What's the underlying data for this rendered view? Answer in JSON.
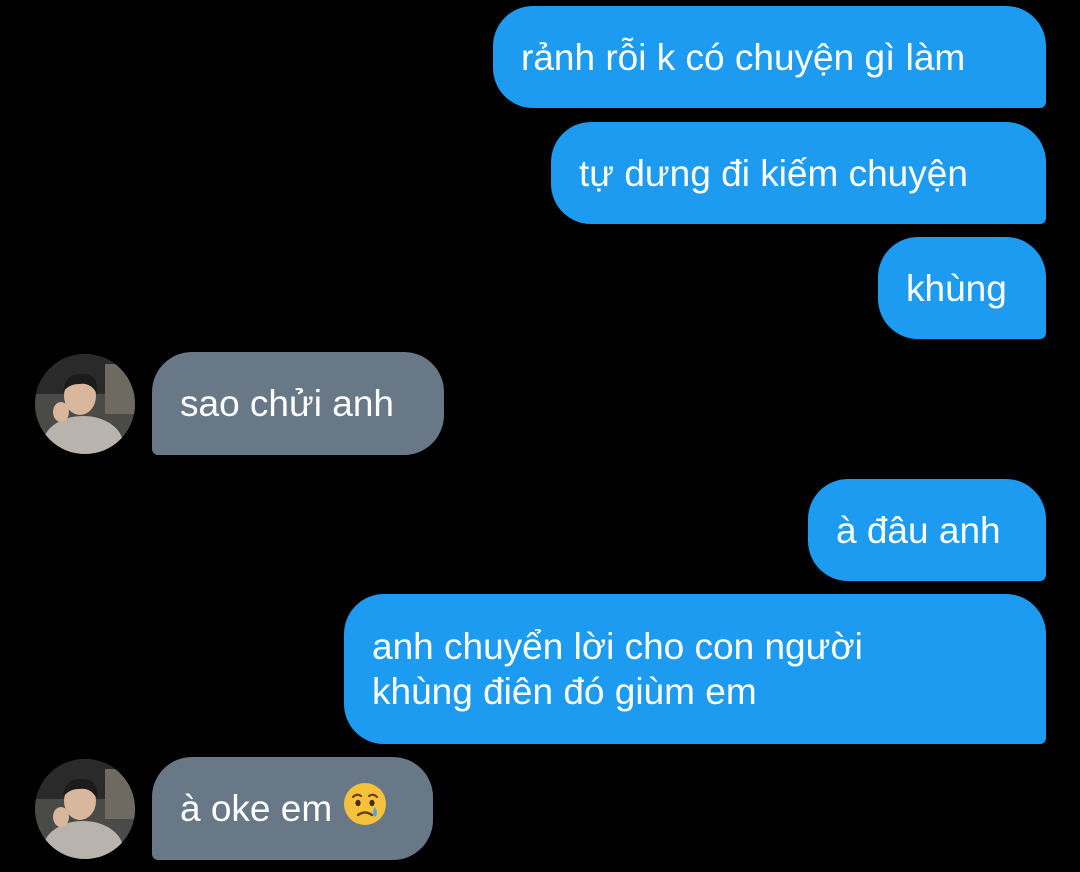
{
  "messages": [
    {
      "id": "m1",
      "direction": "sent",
      "text": "rảnh rỗi k có chuyện gì làm"
    },
    {
      "id": "m2",
      "direction": "sent",
      "text": "tự dưng đi kiếm chuyện"
    },
    {
      "id": "m3",
      "direction": "sent",
      "text": "khùng"
    },
    {
      "id": "m4",
      "direction": "received",
      "text": "sao chửi anh"
    },
    {
      "id": "m5",
      "direction": "sent",
      "text": "à đâu anh"
    },
    {
      "id": "m6",
      "direction": "sent",
      "lines": [
        "anh chuyển lời cho con người",
        "khùng điên đó giùm em"
      ]
    },
    {
      "id": "m7",
      "direction": "received",
      "text": "à oke em",
      "emoji": "crying-face-emoji"
    }
  ],
  "colors": {
    "background": "#000000",
    "sent_bubble": "#1d9bf0",
    "received_bubble": "#697886",
    "text": "#ffffff"
  }
}
